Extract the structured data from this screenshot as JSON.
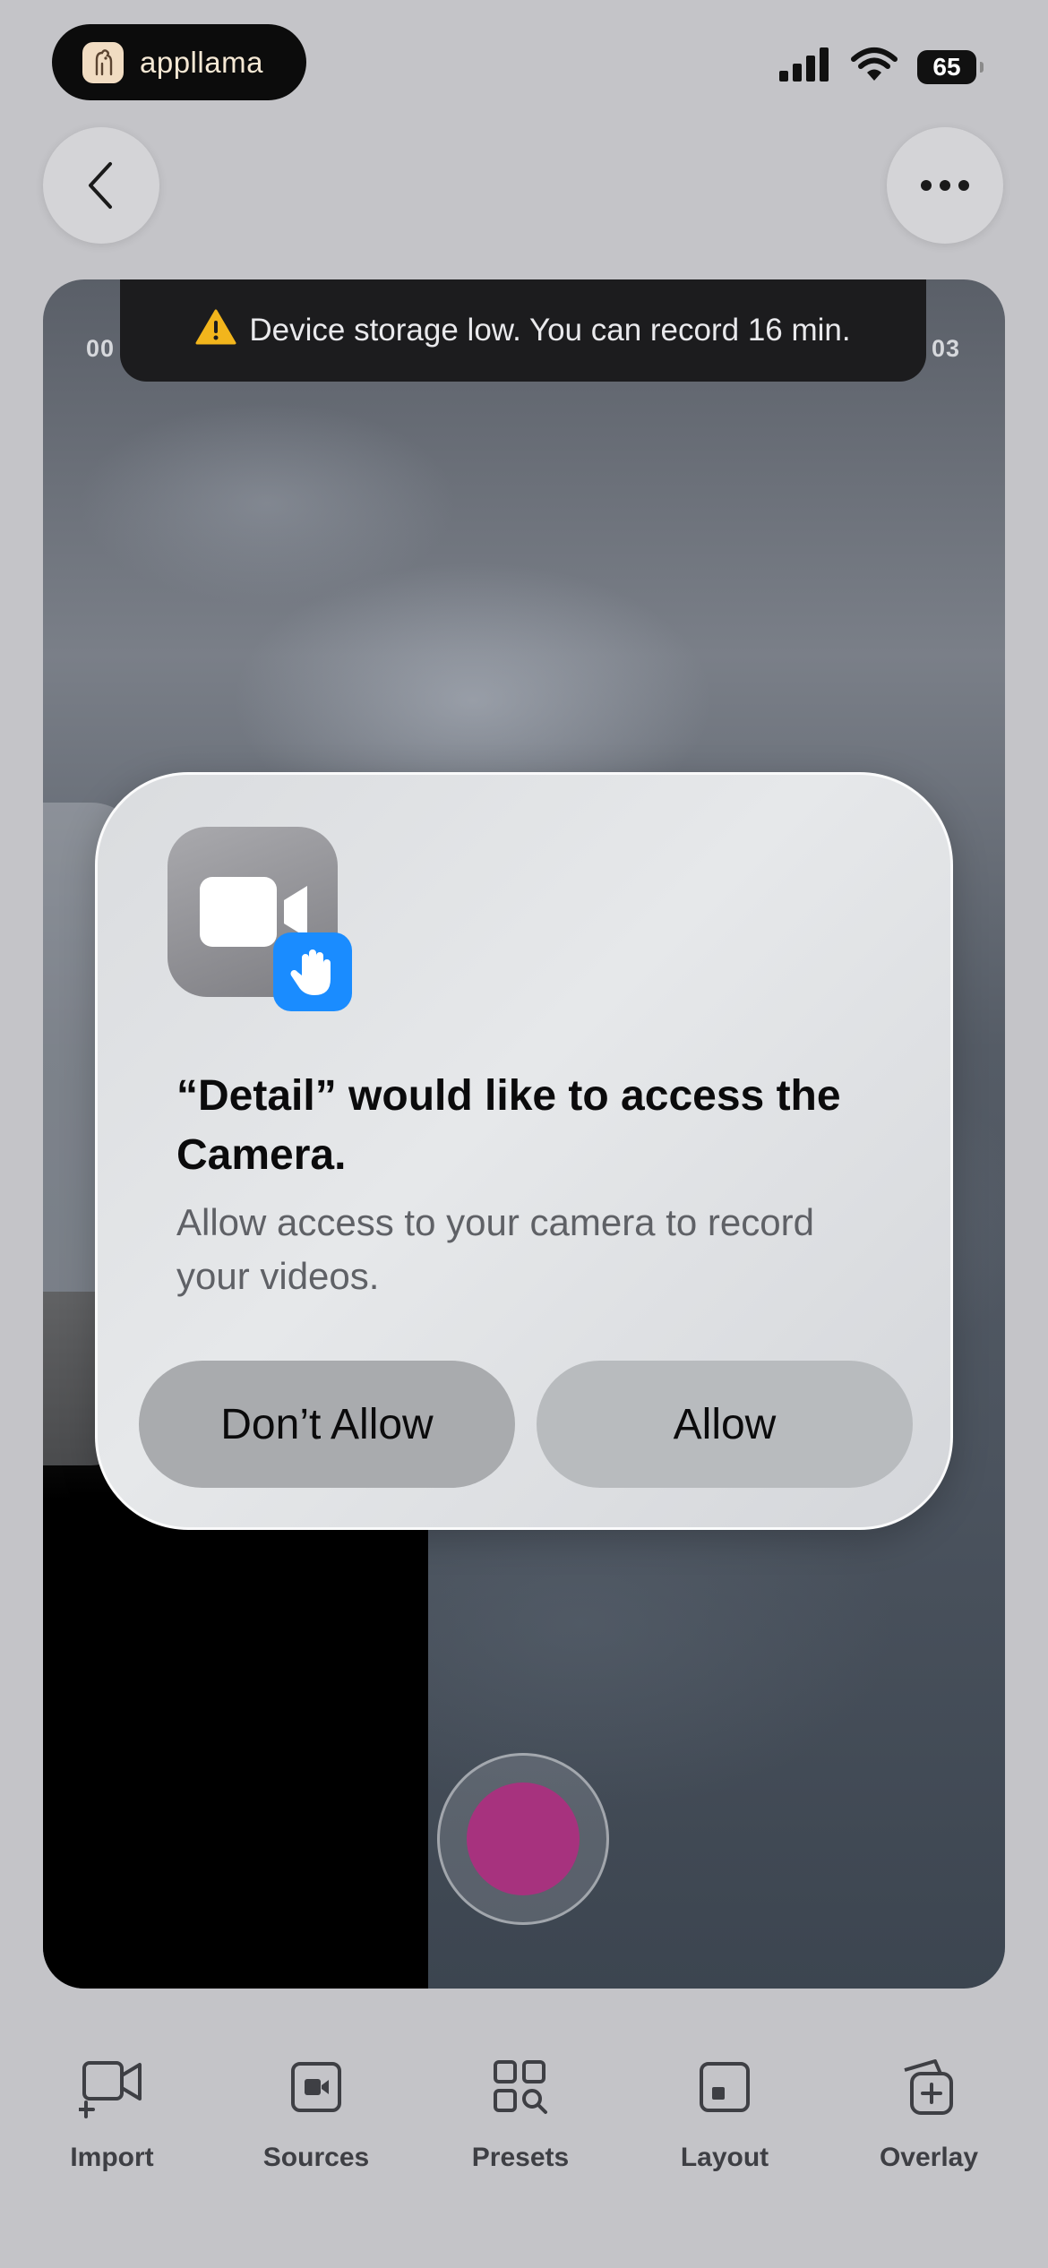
{
  "status_bar": {
    "brand": "appllama",
    "battery": "65"
  },
  "preview": {
    "timecode_left": "00",
    "timecode_right": "03",
    "storage_warning": "Device storage low. You can record 16 min."
  },
  "alert": {
    "title": "“Detail” would like to access the Camera.",
    "message": "Allow access to your camera to record your videos.",
    "deny_label": "Don’t Allow",
    "allow_label": "Allow"
  },
  "toolbar": {
    "items": [
      {
        "label": "Import",
        "icon": "video-plus-icon"
      },
      {
        "label": "Sources",
        "icon": "video-source-icon"
      },
      {
        "label": "Presets",
        "icon": "grid-search-icon"
      },
      {
        "label": "Layout",
        "icon": "layout-icon"
      },
      {
        "label": "Overlay",
        "icon": "overlay-plus-icon"
      }
    ]
  },
  "colors": {
    "record": "#a7327e",
    "badge_blue": "#1a8cff",
    "background": "#c4c4c8"
  }
}
